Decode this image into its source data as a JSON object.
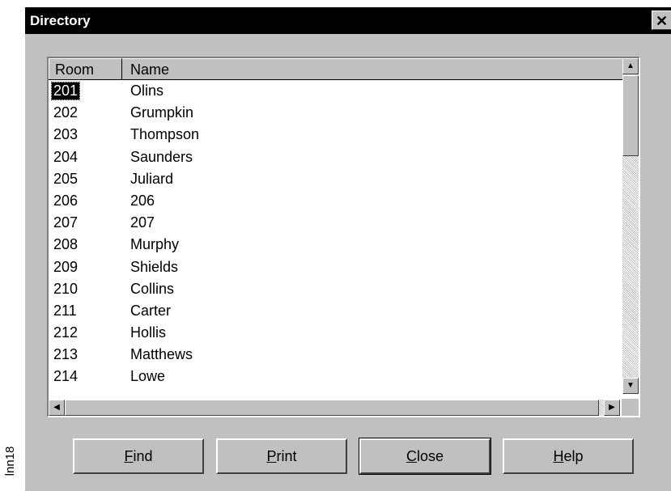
{
  "side_label": "lnn18",
  "window": {
    "title": "Directory",
    "close_glyph": "✕"
  },
  "columns": {
    "room": "Room",
    "name": "Name"
  },
  "rows": [
    {
      "room": "201",
      "name": "Olins"
    },
    {
      "room": "202",
      "name": "Grumpkin"
    },
    {
      "room": "203",
      "name": "Thompson"
    },
    {
      "room": "204",
      "name": "Saunders"
    },
    {
      "room": "205",
      "name": "Juliard"
    },
    {
      "room": "206",
      "name": "206"
    },
    {
      "room": "207",
      "name": "207"
    },
    {
      "room": "208",
      "name": "Murphy"
    },
    {
      "room": "209",
      "name": "Shields"
    },
    {
      "room": "210",
      "name": "Collins"
    },
    {
      "room": "211",
      "name": "Carter"
    },
    {
      "room": "212",
      "name": "Hollis"
    },
    {
      "room": "213",
      "name": "Matthews"
    },
    {
      "room": "214",
      "name": "Lowe"
    }
  ],
  "selected_row": 0,
  "buttons": {
    "find": {
      "pre": "",
      "key": "F",
      "post": "ind"
    },
    "print": {
      "pre": "",
      "key": "P",
      "post": "rint"
    },
    "close": {
      "pre": "",
      "key": "C",
      "post": "lose"
    },
    "help": {
      "pre": "",
      "key": "H",
      "post": "elp"
    }
  },
  "icons": {
    "up": "▲",
    "down": "▼",
    "left": "◀",
    "right": "▶"
  }
}
